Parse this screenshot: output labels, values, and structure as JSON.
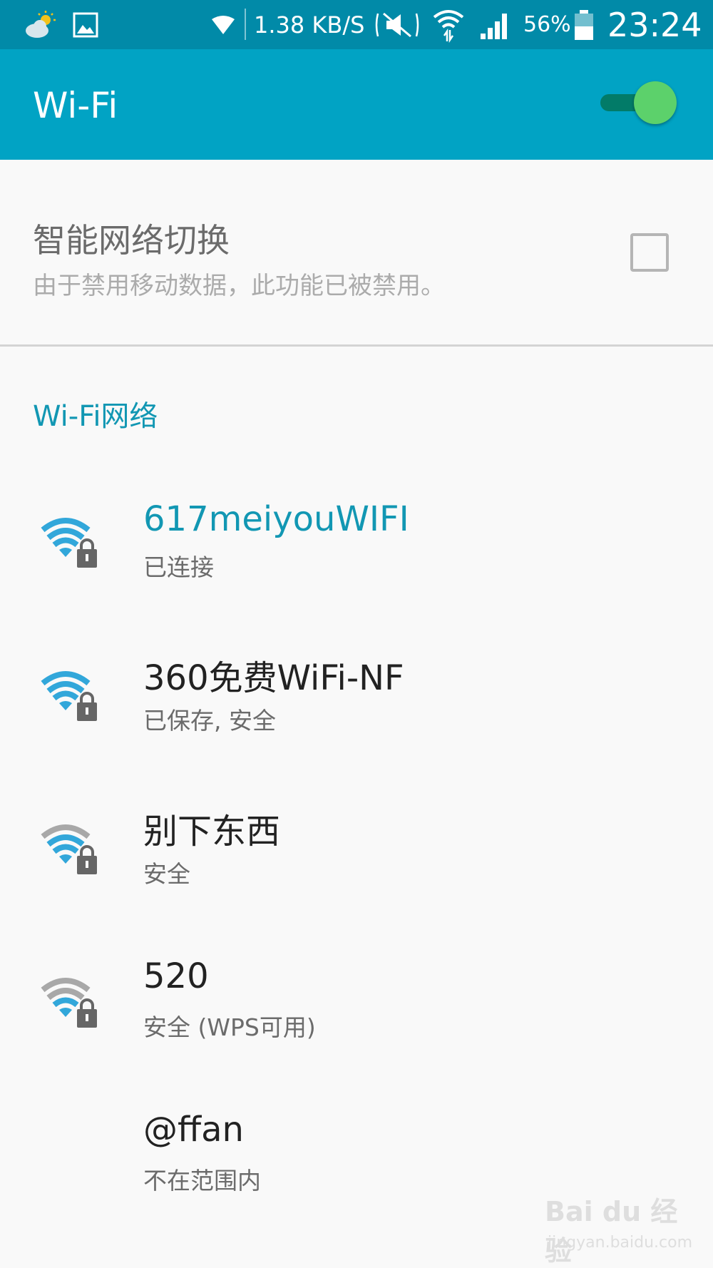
{
  "status_bar": {
    "speed": "1.38 KB/S",
    "battery_percent": "56%",
    "time": "23:24",
    "icons": [
      "weather-icon",
      "gallery-icon",
      "wifi-small-icon",
      "mute-icon",
      "wifi-icon",
      "signal-icon",
      "battery-icon"
    ]
  },
  "app_bar": {
    "title": "Wi-Fi",
    "toggle_on": true
  },
  "smart_switch": {
    "title": "智能网络切换",
    "subtitle": "由于禁用移动数据，此功能已被禁用。",
    "checked": false
  },
  "section": {
    "header": "Wi-Fi网络"
  },
  "networks": [
    {
      "name": "617meiyouWIFI",
      "status": "已连接",
      "signal_bars": 4,
      "secured": true,
      "connected": true
    },
    {
      "name": "360免费WiFi-NF",
      "status": "已保存, 安全",
      "signal_bars": 4,
      "secured": true,
      "connected": false
    },
    {
      "name": "别下东西",
      "status": "安全",
      "signal_bars": 3,
      "secured": true,
      "connected": false
    },
    {
      "name": "520",
      "status": "安全 (WPS可用)",
      "signal_bars": 2,
      "secured": true,
      "connected": false
    },
    {
      "name": "@ffan",
      "status": "不在范围内",
      "signal_bars": 0,
      "secured": false,
      "connected": false
    }
  ],
  "watermark": {
    "logo": "Bai du 经验",
    "url": "jingyan.baidu.com"
  },
  "colors": {
    "status_bar": "#018aa8",
    "app_bar": "#01a3c4",
    "accent": "#1297b3",
    "toggle_thumb": "#5cd16b",
    "wifi_active": "#32a7da",
    "wifi_inactive": "#a8a8a8",
    "lock": "#666666"
  }
}
